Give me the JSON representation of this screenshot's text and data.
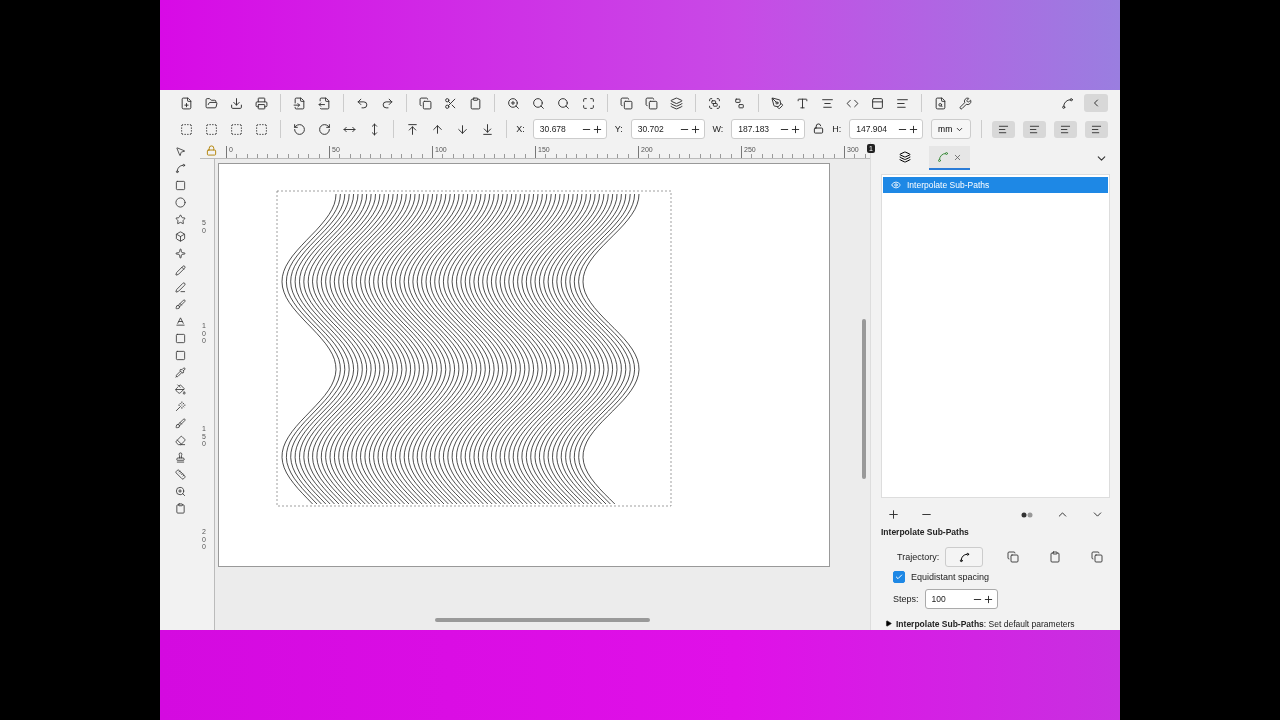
{
  "toolbar": {
    "fields": [
      {
        "label": "X:",
        "value": "30.678"
      },
      {
        "label": "Y:",
        "value": "30.702"
      },
      {
        "label": "W:",
        "value": "187.183"
      },
      {
        "label": "H:",
        "value": "147.904"
      }
    ],
    "unit": "mm",
    "lock_ratio": false
  },
  "rulers": {
    "horizontal": [
      "0",
      "50",
      "100",
      "150",
      "200",
      "250",
      "300"
    ],
    "vertical": [
      "50",
      "100",
      "150",
      "200"
    ],
    "page_badge": "1"
  },
  "dialog": {
    "tabs": [
      {
        "kind": "layers",
        "selected": false
      },
      {
        "kind": "effects",
        "selected": true
      }
    ],
    "effects": [
      {
        "label": "Interpolate Sub-Paths",
        "selected": true,
        "visible": true
      }
    ],
    "section_title": "Interpolate Sub-Paths",
    "trajectory_label": "Trajectory:",
    "equidistant": {
      "label": "Equidistant spacing",
      "checked": true
    },
    "steps": {
      "label": "Steps:",
      "value": "100"
    },
    "footer": "**Interpolate Sub-Paths**: Set default parameters",
    "footer_expanded": false
  }
}
